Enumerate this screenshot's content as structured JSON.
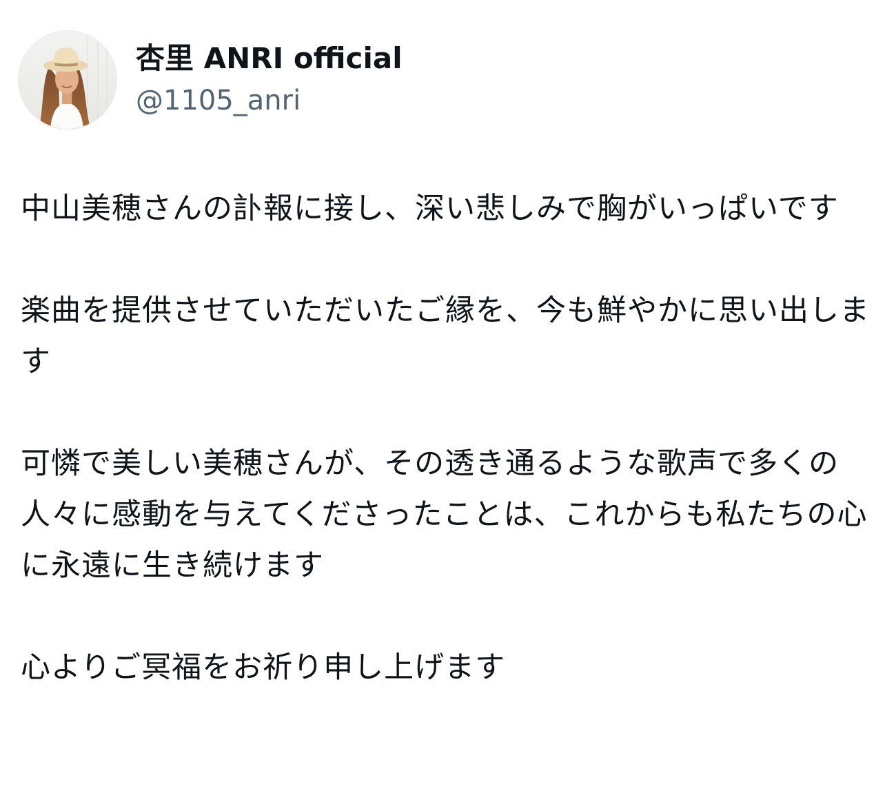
{
  "author": {
    "display_name": "杏里 ANRI official",
    "handle": "@1105_anri",
    "avatar_icon": "profile-photo"
  },
  "tweet": {
    "paragraphs": [
      "中山美穂さんの訃報に接し、深い悲しみで胸がいっぱいです",
      "楽曲を提供させていただいたご縁を、今も鮮やかに思い出します",
      "可憐で美しい美穂さんが、その透き通るような歌声で多くの人々に感動を与えてくださったことは、これからも私たちの心に永遠に生き続けます",
      "心よりご冥福をお祈り申し上げます"
    ]
  },
  "colors": {
    "text_primary": "#0f1419",
    "text_secondary": "#536471",
    "background": "#ffffff"
  }
}
